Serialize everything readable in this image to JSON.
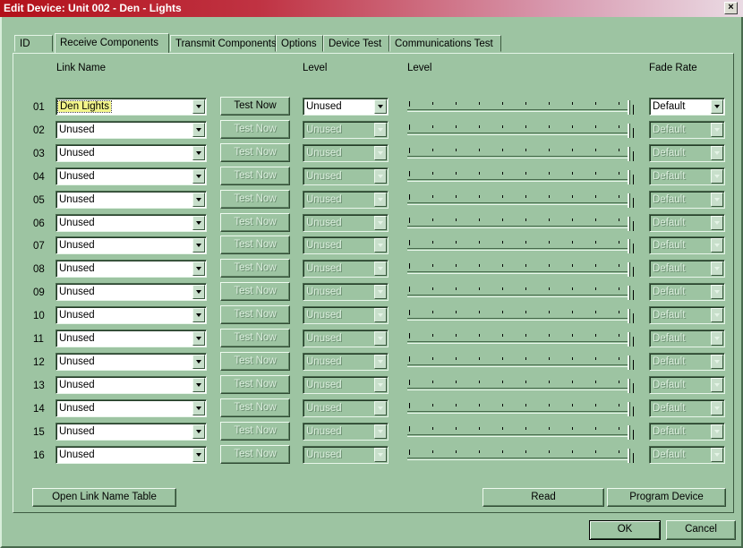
{
  "window": {
    "title": "Edit Device: Unit 002 - Den - Lights"
  },
  "tabs": [
    {
      "label": "ID"
    },
    {
      "label": "Receive Components"
    },
    {
      "label": "Transmit Components"
    },
    {
      "label": "Options"
    },
    {
      "label": "Device Test"
    },
    {
      "label": "Communications Test"
    }
  ],
  "headers": {
    "link_name": "Link Name",
    "level": "Level",
    "level2": "Level",
    "fade_rate": "Fade Rate"
  },
  "rows": [
    {
      "num": "01",
      "link": "Den Lights",
      "test": "Test Now",
      "level": "Unused",
      "fade": "Default"
    },
    {
      "num": "02",
      "link": "Unused",
      "test": "Test Now",
      "level": "Unused",
      "fade": "Default"
    },
    {
      "num": "03",
      "link": "Unused",
      "test": "Test Now",
      "level": "Unused",
      "fade": "Default"
    },
    {
      "num": "04",
      "link": "Unused",
      "test": "Test Now",
      "level": "Unused",
      "fade": "Default"
    },
    {
      "num": "05",
      "link": "Unused",
      "test": "Test Now",
      "level": "Unused",
      "fade": "Default"
    },
    {
      "num": "06",
      "link": "Unused",
      "test": "Test Now",
      "level": "Unused",
      "fade": "Default"
    },
    {
      "num": "07",
      "link": "Unused",
      "test": "Test Now",
      "level": "Unused",
      "fade": "Default"
    },
    {
      "num": "08",
      "link": "Unused",
      "test": "Test Now",
      "level": "Unused",
      "fade": "Default"
    },
    {
      "num": "09",
      "link": "Unused",
      "test": "Test Now",
      "level": "Unused",
      "fade": "Default"
    },
    {
      "num": "10",
      "link": "Unused",
      "test": "Test Now",
      "level": "Unused",
      "fade": "Default"
    },
    {
      "num": "11",
      "link": "Unused",
      "test": "Test Now",
      "level": "Unused",
      "fade": "Default"
    },
    {
      "num": "12",
      "link": "Unused",
      "test": "Test Now",
      "level": "Unused",
      "fade": "Default"
    },
    {
      "num": "13",
      "link": "Unused",
      "test": "Test Now",
      "level": "Unused",
      "fade": "Default"
    },
    {
      "num": "14",
      "link": "Unused",
      "test": "Test Now",
      "level": "Unused",
      "fade": "Default"
    },
    {
      "num": "15",
      "link": "Unused",
      "test": "Test Now",
      "level": "Unused",
      "fade": "Default"
    },
    {
      "num": "16",
      "link": "Unused",
      "test": "Test Now",
      "level": "Unused",
      "fade": "Default"
    }
  ],
  "buttons": {
    "open_link_table": "Open Link Name Table",
    "read": "Read",
    "program": "Program Device",
    "ok": "OK",
    "cancel": "Cancel"
  },
  "slider_level_fraction": 1.0
}
